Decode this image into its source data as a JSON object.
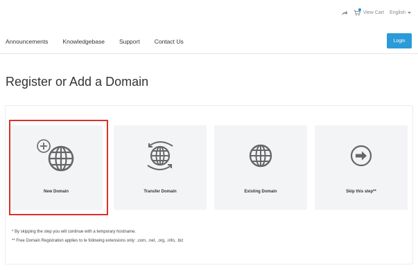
{
  "topbar": {
    "share_icon": "share-arrow-icon",
    "cart_icon": "cart-icon",
    "cart_label": "View Cart",
    "language_label": "English",
    "accent_color": "#2a8fd8"
  },
  "nav": {
    "links": [
      "Announcements",
      "Knowledgebase",
      "Support",
      "Contact Us"
    ],
    "login_label": "Login",
    "login_color": "#2b9ad8"
  },
  "page": {
    "title": "Register or Add a Domain"
  },
  "options": [
    {
      "label": "New Domain",
      "icon": "globe-plus-icon",
      "selected": true
    },
    {
      "label": "Transfer Domain",
      "icon": "globe-transfer-icon",
      "selected": false
    },
    {
      "label": "Existing Domain",
      "icon": "globe-icon",
      "selected": false
    },
    {
      "label": "Skip this step**",
      "icon": "arrow-right-circle-icon",
      "selected": false
    }
  ],
  "notes": {
    "line1": "* By skipping the step you will continue with a temporary hostname.",
    "line2": "** Free Domain Registration applies to te following extensions only: .com, .net, .org, .info, .biz"
  },
  "highlight_color": "#d8312a"
}
